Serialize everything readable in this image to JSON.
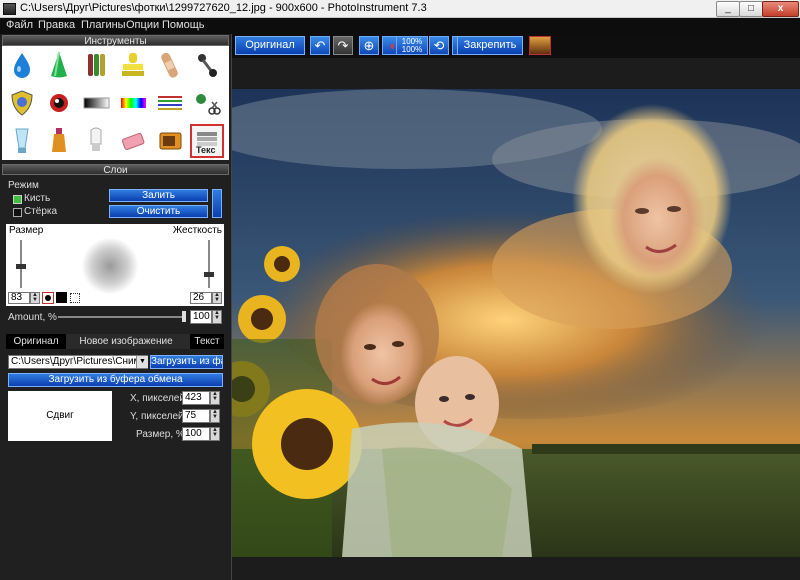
{
  "window": {
    "title": "C:\\Users\\Друг\\Pictures\\фотки\\1299727620_12.jpg - 900x600 - PhotoInstrument 7.3",
    "minimize_label": "_",
    "maximize_label": "□",
    "close_label": "x"
  },
  "menu": {
    "items": [
      "Файл",
      "Правка",
      "Плагины",
      "Опции",
      "Помощь"
    ]
  },
  "tools_panel": {
    "title": "Инструменты",
    "tools": [
      {
        "name": "drop-tool-icon"
      },
      {
        "name": "cone-tool-icon"
      },
      {
        "name": "tubes-tool-icon"
      },
      {
        "name": "stamp-tool-icon"
      },
      {
        "name": "bandage-tool-icon"
      },
      {
        "name": "pin-tool-icon"
      },
      {
        "name": "shield-tool-icon"
      },
      {
        "name": "eye-tool-icon"
      },
      {
        "name": "gradient-tool-icon"
      },
      {
        "name": "rainbow-tool-icon"
      },
      {
        "name": "lines-tool-icon"
      },
      {
        "name": "scissors-tool-icon"
      },
      {
        "name": "glass-tool-icon"
      },
      {
        "name": "bottle-tool-icon"
      },
      {
        "name": "lightbulb-tool-icon"
      },
      {
        "name": "eraser-tool-icon"
      },
      {
        "name": "tv-tool-icon"
      },
      {
        "name": "text-tool-icon"
      }
    ],
    "text_tool_label": "Текс"
  },
  "layers_panel": {
    "title": "Слои",
    "mode_label": "Режим",
    "brush_label": "Кисть",
    "eraser_label": "Стёрка",
    "fill_button": "Залить",
    "clear_button": "Очистить",
    "size_label": "Размер",
    "hardness_label": "Жесткость",
    "size_value": "83",
    "hardness_value": "26",
    "amount_label": "Amount, %",
    "amount_value": "100"
  },
  "image_tabs": {
    "tabs": [
      "Оригинал",
      "Новое изображение",
      "Текст"
    ],
    "active": 0
  },
  "source": {
    "path_value": "C:\\Users\\Друг\\Pictures\\Снимок",
    "load_file_button": "Загрузить из файла",
    "load_clipboard_button": "Загрузить из буфера обмена",
    "preview_label": "Сдвиг",
    "x_label": "X, пикселей:",
    "x_value": "423",
    "y_label": "Y, пикселей:",
    "y_value": "75",
    "size_label": "Размер, %:",
    "size_value": "100"
  },
  "toolbar": {
    "original_button": "Оригинал",
    "zoom_top": "100%",
    "zoom_bottom": "100%",
    "pin_button": "Закрепить"
  },
  "colors": {
    "accent_blue": "#1a5fd0",
    "panel_bg": "#202020",
    "menu_bg": "#0d0d0d"
  }
}
